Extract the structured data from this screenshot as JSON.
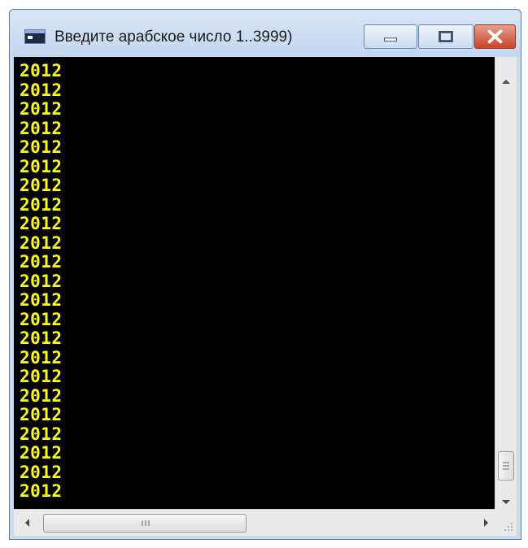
{
  "window": {
    "title": "Введите арабское число 1..3999)"
  },
  "console": {
    "lines": [
      "2012",
      "2012",
      "2012",
      "2012",
      "2012",
      "2012",
      "2012",
      "2012",
      "2012",
      "2012",
      "2012",
      "2012",
      "2012",
      "2012",
      "2012",
      "2012",
      "2012",
      "2012",
      "2012",
      "2012",
      "2012",
      "2012",
      "2012"
    ]
  },
  "colors": {
    "console_background": "#000000",
    "console_text": "#ffff00",
    "close_button": "#c9442a"
  },
  "scrollbars": {
    "vertical_position": 0.95,
    "horizontal_position": 0.0
  }
}
